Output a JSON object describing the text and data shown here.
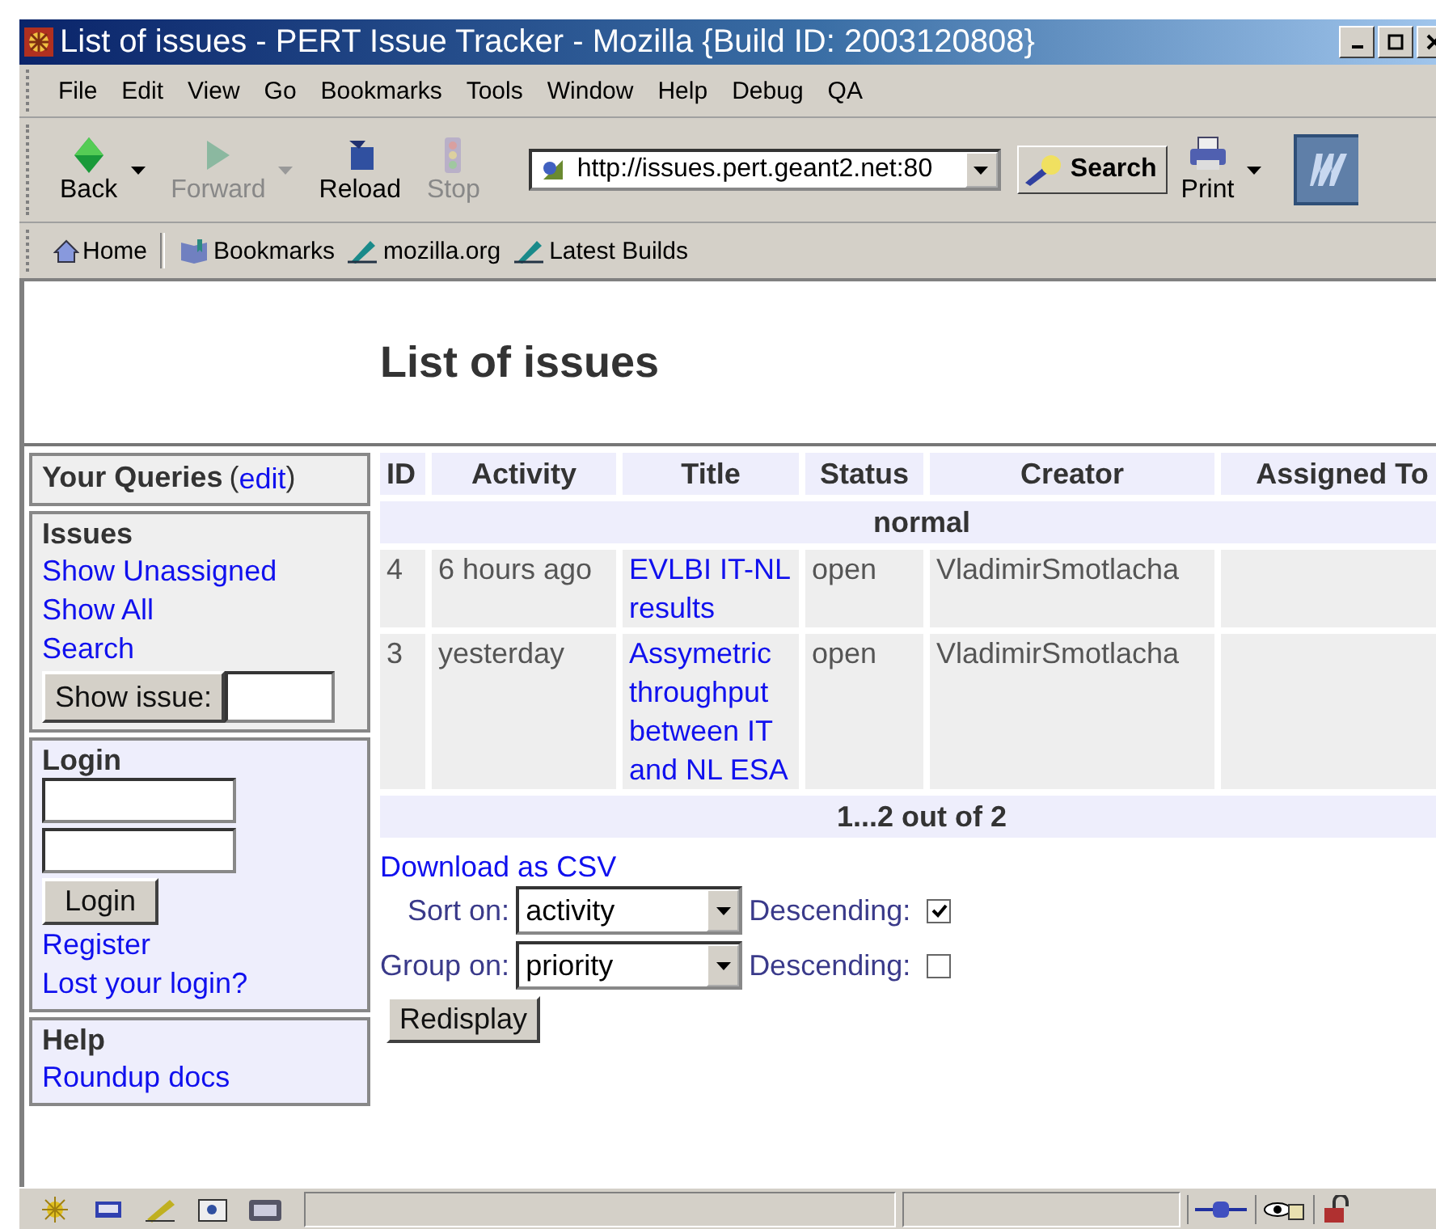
{
  "window": {
    "title": "List of issues - PERT Issue Tracker - Mozilla {Build ID: 2003120808}"
  },
  "menu": [
    "File",
    "Edit",
    "View",
    "Go",
    "Bookmarks",
    "Tools",
    "Window",
    "Help",
    "Debug",
    "QA"
  ],
  "nav_buttons": [
    {
      "kind": "back",
      "label": "Back",
      "disabled": false,
      "dropdown": true
    },
    {
      "kind": "forward",
      "label": "Forward",
      "disabled": true,
      "dropdown": true
    },
    {
      "kind": "reload",
      "label": "Reload",
      "disabled": false,
      "dropdown": false
    },
    {
      "kind": "stop",
      "label": "Stop",
      "disabled": true,
      "dropdown": false
    }
  ],
  "url": "http://issues.pert.geant2.net:80",
  "search_button": "Search",
  "print_button": "Print",
  "bookmarks_toolbar": [
    {
      "kind": "home",
      "label": "Home"
    },
    {
      "kind": "bookmarks",
      "label": "Bookmarks"
    },
    {
      "kind": "link",
      "label": "mozilla.org"
    },
    {
      "kind": "link",
      "label": "Latest Builds"
    }
  ],
  "page": {
    "heading": "List of issues"
  },
  "sidebar": {
    "queries_title": "Your Queries",
    "queries_paren_open": "(",
    "queries_edit": "edit",
    "queries_paren_close": ")",
    "issues": {
      "title": "Issues",
      "links": [
        "Show Unassigned",
        "Show All",
        "Search"
      ],
      "show_issue_button": "Show issue:"
    },
    "login": {
      "title": "Login",
      "button": "Login",
      "links": [
        "Register",
        "Lost your login?"
      ]
    },
    "help": {
      "title": "Help",
      "links": [
        "Roundup docs"
      ]
    }
  },
  "table": {
    "columns": [
      "ID",
      "Activity",
      "Title",
      "Status",
      "Creator",
      "Assigned To"
    ],
    "group": "normal",
    "rows": [
      {
        "id": "4",
        "activity": "6 hours ago",
        "title": "EVLBI IT-NL results",
        "status": "open",
        "creator": "VladimirSmotlacha"
      },
      {
        "id": "3",
        "activity": "yesterday",
        "title": "Assymetric throughput between IT and NL ESA",
        "status": "open",
        "creator": "VladimirSmotlacha"
      }
    ],
    "footer": "1...2 out of 2"
  },
  "download_link": "Download as CSV",
  "controls": [
    {
      "label": "Sort on:",
      "value": "activity",
      "descending_label": "Descending:",
      "checked": true
    },
    {
      "label": "Group on:",
      "value": "priority",
      "descending_label": "Descending:",
      "checked": false
    }
  ],
  "redisplay_button": "Redisplay"
}
